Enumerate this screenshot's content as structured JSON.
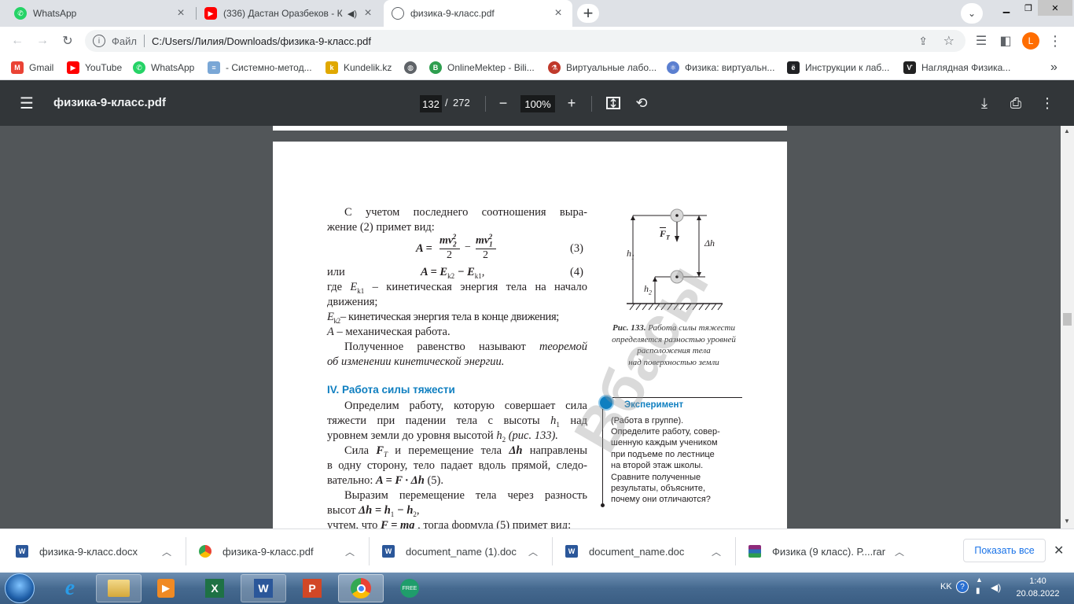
{
  "browser": {
    "tabs": [
      {
        "title": "WhatsApp",
        "icon": "whatsapp-icon",
        "active": false
      },
      {
        "title": "(336) Дастан Оразбеков - Ке",
        "icon": "youtube-icon",
        "active": false
      },
      {
        "title": "физика-9-класс.pdf",
        "icon": "globe-icon",
        "active": true
      }
    ],
    "new_tab_label": "+",
    "address": {
      "scheme_label": "Файл",
      "url": "C:/Users/Лилия/Downloads/физика-9-класс.pdf"
    },
    "profile_initial": "L",
    "accent_color": "#ff6d00",
    "bookmarks": [
      {
        "label": "Gmail",
        "icon": "gmail-icon",
        "color": "#ea4335"
      },
      {
        "label": "YouTube",
        "icon": "youtube-icon",
        "color": "#ff0000"
      },
      {
        "label": "WhatsApp",
        "icon": "whatsapp-icon",
        "color": "#25d366"
      },
      {
        "label": "- Системно-метод...",
        "icon": "document-icon",
        "color": "#7aa7d6"
      },
      {
        "label": "Kundelik.kz",
        "icon": "kundelik-icon",
        "color": "#e0a800"
      },
      {
        "label": "",
        "icon": "globe-icon",
        "color": "#5f6368"
      },
      {
        "label": "OnlineMektep - Bili...",
        "icon": "onlinemektep-icon",
        "color": "#2e9e4f"
      },
      {
        "label": "Виртуальные лабо...",
        "icon": "lab-icon",
        "color": "#c0392b"
      },
      {
        "label": "Физика: виртуальн...",
        "icon": "atom-icon",
        "color": "#5b7fd0"
      },
      {
        "label": "Инструкции к лаб...",
        "icon": "e-icon",
        "color": "#202124"
      },
      {
        "label": "Наглядная Физика...",
        "icon": "vf-icon",
        "color": "#222222"
      }
    ],
    "bookmarks_overflow": "»"
  },
  "pdf_viewer": {
    "title": "физика-9-класс.pdf",
    "current_page": "132",
    "page_separator": "/",
    "total_pages": "272",
    "zoom": "100%"
  },
  "document": {
    "p1_l1": "С учетом последнего соотношения выра-",
    "p1_l2": "жение (2) примет вид:",
    "eq3_lhs": "A =",
    "eq3_n1": "mv",
    "eq3_sup1": "2",
    "eq3_sub1": "2",
    "eq3_den1": "2",
    "eq3_minus": "−",
    "eq3_n2": "mv",
    "eq3_sup2": "2",
    "eq3_sub2": "1",
    "eq3_den2": "2",
    "eq3_num": "(3)",
    "or_word": "или",
    "eq4_a": "A = E",
    "eq4_s1": "k2",
    "eq4_b": " − E",
    "eq4_s2": "k1",
    "eq4_c": ",",
    "eq4_num": "(4)",
    "where_a": "где ",
    "where_E": "E",
    "where_s": "k1",
    "where_b": " – кинетическая энергия тела на начало",
    "where_l2": "движения;",
    "ek2_E": "E",
    "ek2_s": "k2",
    "ek2_text": "– кинетическая энергия тела в конце движения;",
    "a_text_A": "A",
    "a_text": " – механическая работа.",
    "p2_a": "Полученное равенство называют ",
    "p2_b": "теоремой",
    "p2_l2": "об изменении кинетической энергии.",
    "section_heading": "IV. Работа силы тяжести",
    "p3_l1": "Определим работу, которую совершает сила",
    "p3_l2a": "тяжести при падении тела с высоты ",
    "p3_l2h": "h",
    "p3_l2s": "1",
    "p3_l2b": " над",
    "p3_l3a": "уровнем земли до уровня высотой ",
    "p3_l3h": "h",
    "p3_l3s": "2",
    "p3_l3b": " (рис. 133).",
    "p4_l1a": "Сила ",
    "p4_l1F": "F",
    "p4_l1s": "T",
    "p4_l1b": " и перемещение тела ",
    "p4_l1dh": "Δh",
    "p4_l1c": " направлены",
    "p4_l2": "в одну сторону, тело падает вдоль прямой, следо-",
    "p4_l3a": "вательно: ",
    "p4_l3m": "A = F · Δh",
    "p4_l3b": "   (5).",
    "p5_l1": "Выразим перемещение тела через разность",
    "p5_l2a": "высот  ",
    "p5_l2m": "Δh = h",
    "p5_l2s1": "1",
    "p5_l2m2": " − h",
    "p5_l2s2": "2",
    "p5_l2b": ",",
    "p6_l1a": "учтем, что  ",
    "p6_l1m": "F = mg",
    "p6_l1b": " , тогда формула (5) примет вид:",
    "fig_h1": "h",
    "fig_h1s": "1",
    "fig_h2": "h",
    "fig_h2s": "2",
    "fig_dh": "Δh",
    "fig_F": "F",
    "fig_Fs": "T",
    "caption_l1a": "Рис. 133.",
    "caption_l1b": " Работа силы тяжести",
    "caption_l2": "определяется разностью уровней",
    "caption_l3": "расположения тела",
    "caption_l4": "над поверхностью земли",
    "experiment_title": "Эксперимент",
    "experiment_lines": [
      "(Работа в группе).",
      "Определите работу, совер-",
      "шенную каждым учеником",
      "при подъеме по лестнице",
      "на второй этаж школы.",
      "Сравните полученные",
      "результаты, объясните,",
      "почему они отличаются?"
    ],
    "watermark": "Вбасы"
  },
  "downloads": {
    "items": [
      {
        "name": "физика-9-класс.docx",
        "icon": "word-file-icon"
      },
      {
        "name": "физика-9-класс.pdf",
        "icon": "chrome-file-icon"
      },
      {
        "name": "document_name (1).doc",
        "icon": "word-file-icon"
      },
      {
        "name": "document_name.doc",
        "icon": "word-file-icon"
      },
      {
        "name": "Физика (9 класс). Р....rar",
        "icon": "rar-file-icon"
      }
    ],
    "show_all_label": "Показать все"
  },
  "taskbar": {
    "lang": "KK",
    "time": "1:40",
    "date": "20.08.2022"
  }
}
